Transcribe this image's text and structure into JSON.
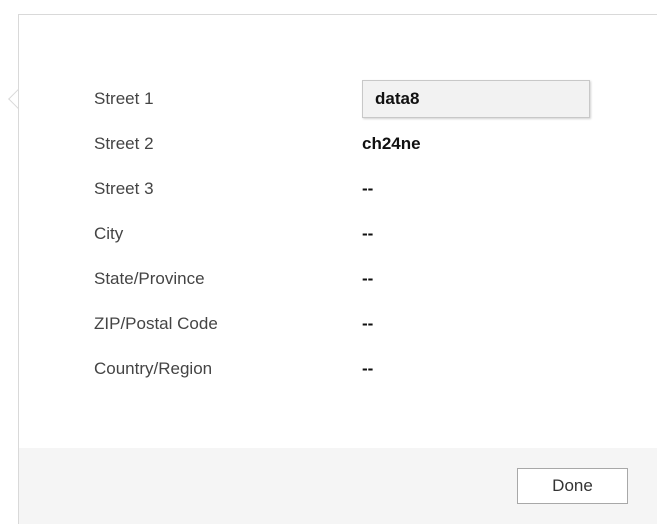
{
  "address": {
    "fields": [
      {
        "label": "Street 1",
        "value": "data8"
      },
      {
        "label": "Street 2",
        "value": "ch24ne"
      },
      {
        "label": "Street 3",
        "value": "--"
      },
      {
        "label": "City",
        "value": "--"
      },
      {
        "label": "State/Province",
        "value": "--"
      },
      {
        "label": "ZIP/Postal Code",
        "value": "--"
      },
      {
        "label": "Country/Region",
        "value": "--"
      }
    ]
  },
  "footer": {
    "done_label": "Done"
  }
}
